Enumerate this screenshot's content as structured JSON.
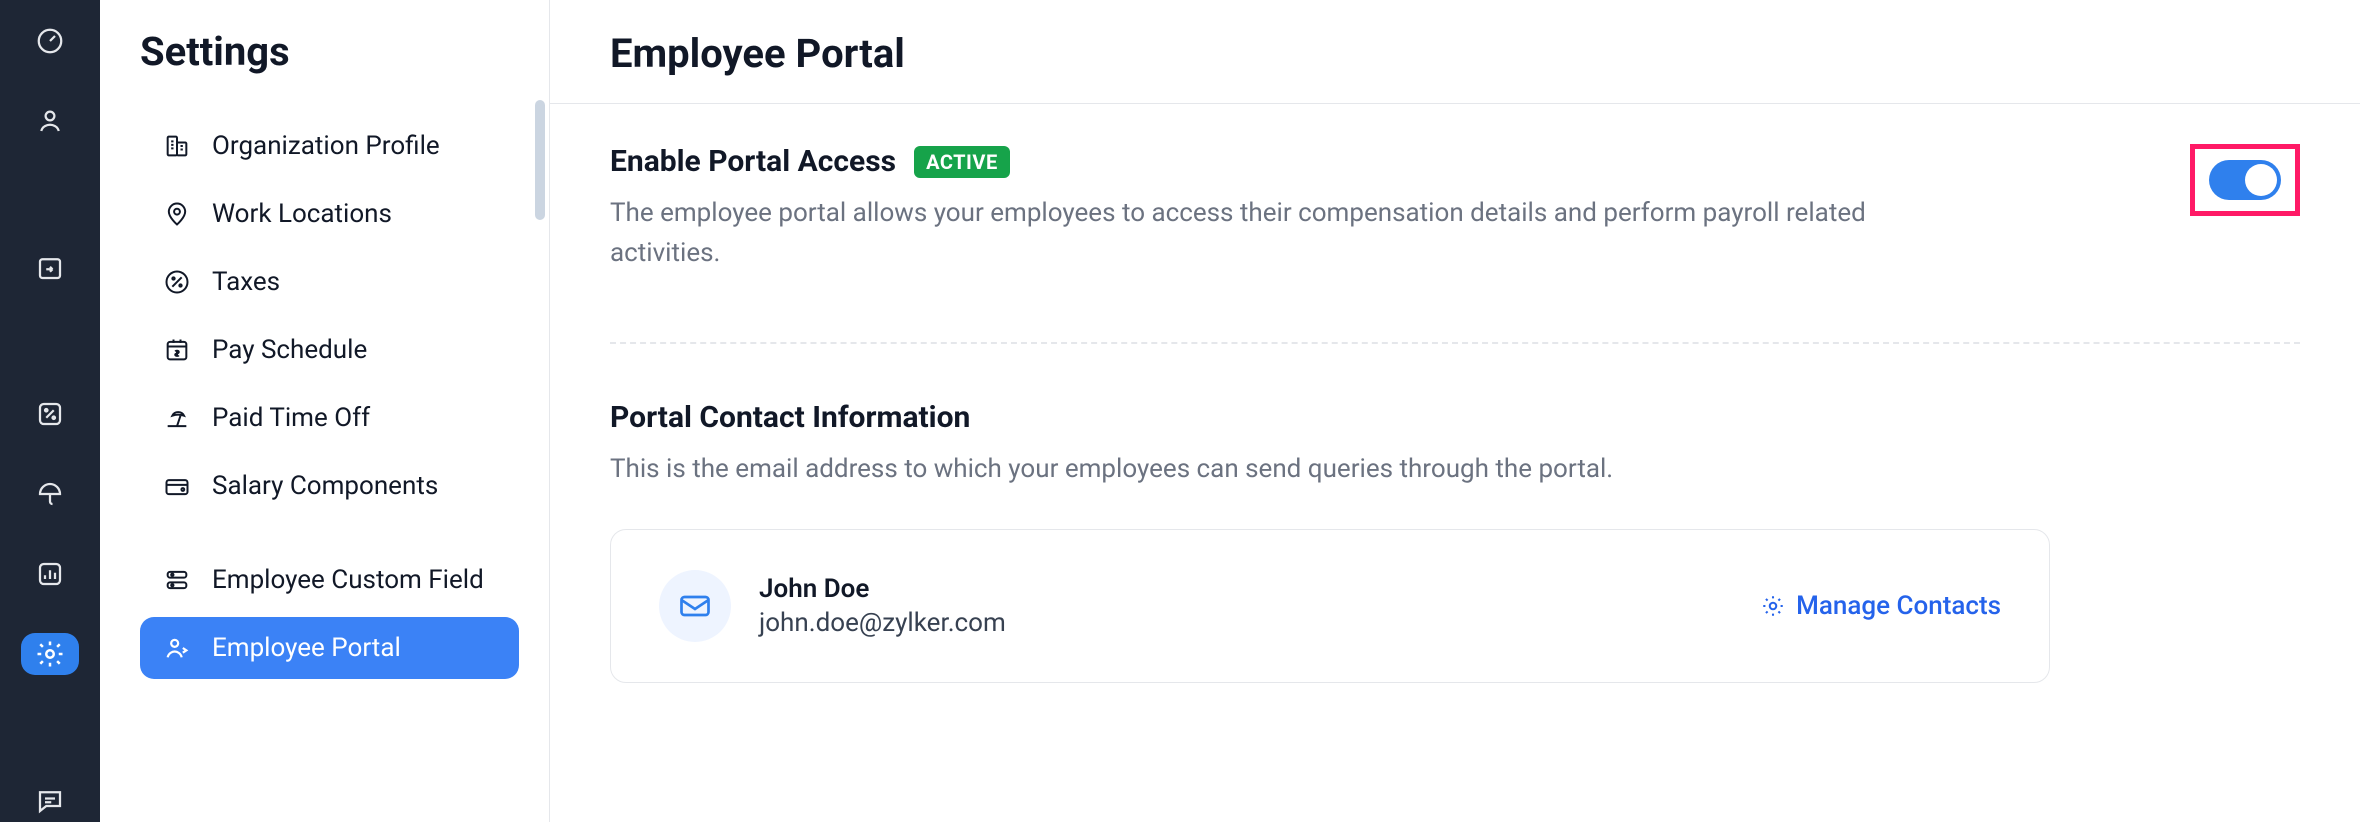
{
  "sidebar": {
    "title": "Settings",
    "items": [
      {
        "label": "Organization Profile",
        "icon": "building-icon",
        "active": false
      },
      {
        "label": "Work Locations",
        "icon": "location-icon",
        "active": false
      },
      {
        "label": "Taxes",
        "icon": "percent-icon",
        "active": false
      },
      {
        "label": "Pay Schedule",
        "icon": "calendar-dollar-icon",
        "active": false
      },
      {
        "label": "Paid Time Off",
        "icon": "beach-icon",
        "active": false
      },
      {
        "label": "Salary Components",
        "icon": "wallet-icon",
        "active": false
      },
      {
        "label": "Employee Custom Field",
        "icon": "custom-field-icon",
        "active": false
      },
      {
        "label": "Employee Portal",
        "icon": "person-portal-icon",
        "active": true
      }
    ]
  },
  "page": {
    "title": "Employee Portal",
    "enable_section": {
      "heading": "Enable Portal Access",
      "badge": "ACTIVE",
      "description": "The employee portal allows your employees to access their compensation details and perform payroll related activities.",
      "toggle_on": true
    },
    "contact_section": {
      "heading": "Portal Contact Information",
      "description": "This is the email address to which your employees can send queries through the portal.",
      "contact_name": "John Doe",
      "contact_email": "john.doe@zylker.com",
      "manage_label": "Manage Contacts"
    }
  }
}
